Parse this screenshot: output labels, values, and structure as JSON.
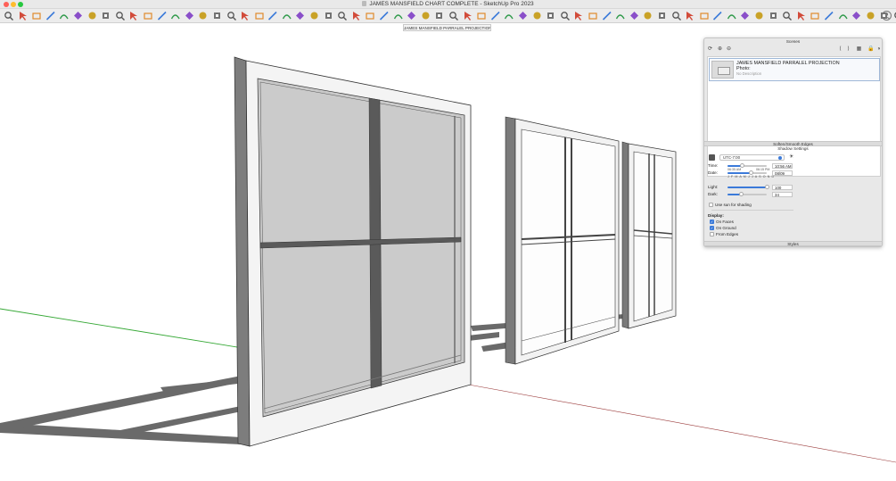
{
  "window": {
    "title": "JAMES MANSFIELD CHART COMPLETE - SketchUp Pro 2023"
  },
  "toolbar": {
    "tools": [
      "zoom-icon",
      "select-icon",
      "eraser-icon",
      "line-icon",
      "arc-icon",
      "rectangle-icon",
      "push-pull-icon",
      "follow-me-icon",
      "paint-bucket-icon",
      "move-icon",
      "rotate-icon",
      "scale-icon",
      "offset-icon",
      "tape-measure-icon",
      "protractor-icon",
      "text-icon",
      "axes-icon",
      "3d-text-icon",
      "orbit-icon",
      "pan-icon",
      "zoom-window-icon",
      "zoom-extents-icon",
      "walk-icon",
      "look-around-icon",
      "position-camera-icon",
      "section-plane-icon",
      "display-section-icon",
      "iso-view-icon",
      "top-view-icon",
      "front-view-icon",
      "right-view-icon",
      "back-view-icon",
      "left-view-icon",
      "bottom-view-icon",
      "xray-icon",
      "wireframe-icon",
      "hidden-line-icon",
      "shaded-icon",
      "textured-icon",
      "monochrome-icon",
      "sandbox-icon",
      "smoove-icon",
      "stamp-icon",
      "drape-icon",
      "add-detail-icon",
      "flip-edge-icon",
      "warehouse-icon",
      "extension-icon",
      "components-icon",
      "layout-icon",
      "solid-union-icon",
      "solid-subtract-icon",
      "solid-trim-icon",
      "solid-split-icon",
      "outer-shell-icon",
      "intersect-icon",
      "geo-location-icon",
      "photo-texture-icon",
      "match-photo-icon",
      "dimension-icon",
      "label-icon",
      "section-fill-icon",
      "ruby-console-icon",
      "extension-manager-icon",
      "styles-icon",
      "shadows-icon",
      "fog-icon",
      "generate-report-icon"
    ]
  },
  "scene_tab": {
    "label": "JAMES MANSFIELD PARRALEL PROJECTION"
  },
  "tray": {
    "scenes_title": "Scenes",
    "scene": {
      "name": "JAMES MANSFIELD PARRALEL PROJECTION",
      "photo_label": "Photo:",
      "description": "No Description"
    },
    "soften_title": "Soften/Smooth Edges",
    "shadow_title": "Shadow Settings",
    "timezone": "UTC-7:00",
    "time_label": "Time:",
    "time_start": "06:35 AM",
    "time_end": "06:15 PM",
    "time_value": "10:56 AM",
    "date_label": "Date:",
    "months": [
      "J",
      "F",
      "M",
      "A",
      "M",
      "J",
      "J",
      "A",
      "S",
      "O",
      "N",
      "D"
    ],
    "date_value": "08/09",
    "light_label": "Light:",
    "light_value": "100",
    "dark_label": "Dark:",
    "dark_value": "34",
    "use_sun_label": "Use sun for shading",
    "display_label": "Display:",
    "on_faces_label": "On Faces",
    "on_ground_label": "On Ground",
    "from_edges_label": "From Edges",
    "styles_title": "Styles",
    "settings": {
      "time_fraction": 0.37,
      "date_fraction": 0.6,
      "light_percent": 100,
      "dark_percent": 34,
      "use_sun": false,
      "on_faces": true,
      "on_ground": true,
      "from_edges": false
    }
  },
  "colors": {
    "green_axis": "#35a835",
    "red_axis": "#c23b3b",
    "accent": "#3b7ad9",
    "glass": "#c9c9c9",
    "shadow": "#666666"
  }
}
